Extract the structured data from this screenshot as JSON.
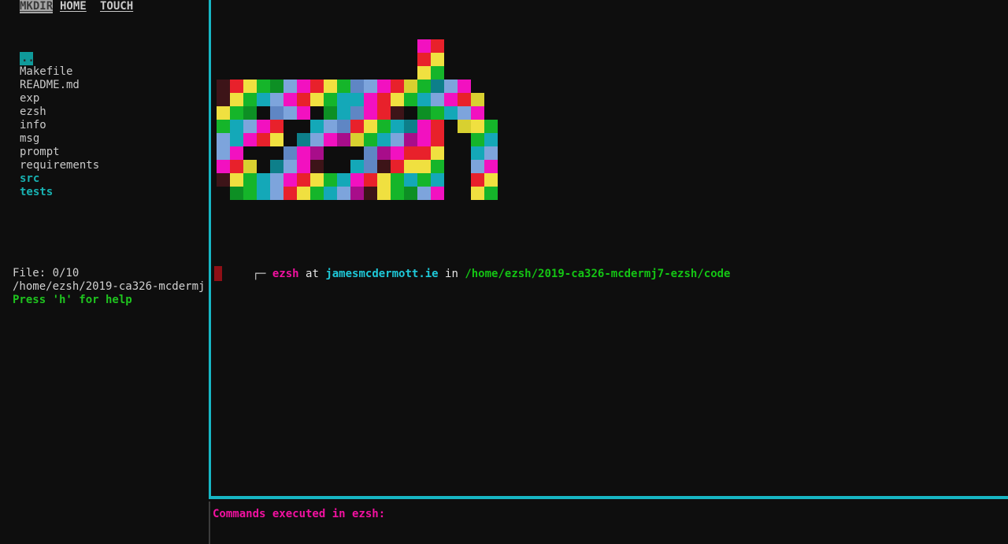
{
  "menu": {
    "items": [
      {
        "label": "MKDIR",
        "selected": true
      },
      {
        "label": "HOME",
        "selected": false
      },
      {
        "label": "TOUCH",
        "selected": false
      }
    ]
  },
  "filebrowser": {
    "parent_entry": "..",
    "files": [
      {
        "name": "Makefile",
        "type": "file"
      },
      {
        "name": "README.md",
        "type": "file"
      },
      {
        "name": "exp",
        "type": "file"
      },
      {
        "name": "ezsh",
        "type": "file"
      },
      {
        "name": "info",
        "type": "file"
      },
      {
        "name": "msg",
        "type": "file"
      },
      {
        "name": "prompt",
        "type": "file"
      },
      {
        "name": "requirements",
        "type": "file"
      },
      {
        "name": "src",
        "type": "dir"
      },
      {
        "name": "tests",
        "type": "dir"
      }
    ],
    "status": {
      "file_counter": "File: 0/10",
      "path": "/home/ezsh/2019-ca326-mcdermj",
      "help": "Press 'h' for help"
    }
  },
  "terminal": {
    "prompt": {
      "corner": "┌─ ",
      "user": "ezsh",
      "at": " at ",
      "host": "jamesmcdermott.ie",
      "in": " in ",
      "path": "/home/ezsh/2019-ca326-mcdermj7-ezsh/code"
    },
    "cursor": "block"
  },
  "bottom_panel": {
    "title": "Commands executed in ezsh:"
  },
  "colors": {
    "background": "#0e0e0e",
    "border": "#17b6c4",
    "dir": "#18b2b2",
    "file": "#c9c9c9",
    "help": "#1fc41f",
    "magenta": "#f211a0",
    "cyan": "#1ec8d8",
    "green": "#14c414",
    "cursor": "#8f0f16",
    "menu_selected_bg": "#a6a6a6"
  },
  "logo": {
    "text": "ezsh",
    "palette": {
      "R": "#e8212b",
      "Y": "#f0e040",
      "G": "#15b52a",
      "C": "#14a8b8",
      "M": "#f211c0",
      "B": "#7da4dc",
      "T": "#0fb0a8",
      "r": "#3d1418",
      "y": "#d8d030",
      "g": "#0d8f24",
      "b": "#5f86c4",
      "m": "#a80d8a",
      "c": "#0d7f8a",
      "k": "#0e0e0e"
    },
    "rows": [
      "..............k...k...k...k...k...MR..............",
      "..............k...k...k...k...k...RY..............",
      "..............k...k...k...k...k...YG..............",
      "rRYG g..k.BMRYG..k.bBMRc..k.GcBM.................",
      "rYGCB..k.MRYGC..k.CMRYGg..k.CBMRy................",
      "YGg.bBM..k.gCb..k.MRr.gGC..k.BM..yYG.............",
      "GCBMR..k..CBb..k.RYGCc..k.MR.....G...............",
      "BCMRY..k.cBMm..k.yGCBm..k.RY.....CB..............",
      "BM....k.bMm..k.bmMR..k.YG.....BM................",
      "MRyc.gC..k.bMr..k.CbrRY..k.GC.....MR.............",
      "rYGCB..k.MRYGC..k.MRYGC..k.CB.....RY.............",
      "gGCBm..k.RYGCB..k.mrYGg..k.BM.....YG............."
    ]
  }
}
